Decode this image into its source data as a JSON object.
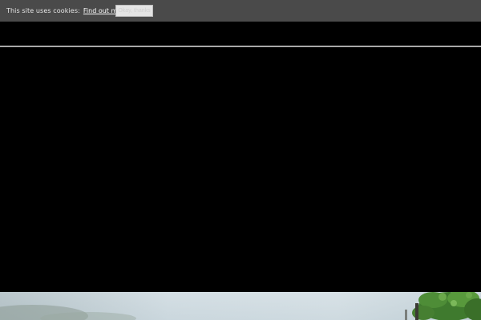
{
  "cookie_banner": {
    "message": "This site uses cookies:",
    "link_label": "Find out more.",
    "accept_label": "Okay, thanks"
  },
  "colors": {
    "banner_bg": "#4a4a4a",
    "page_bg": "#000000",
    "divider": "#a8a8a8"
  },
  "hero": {
    "icon": "hero-photo"
  }
}
